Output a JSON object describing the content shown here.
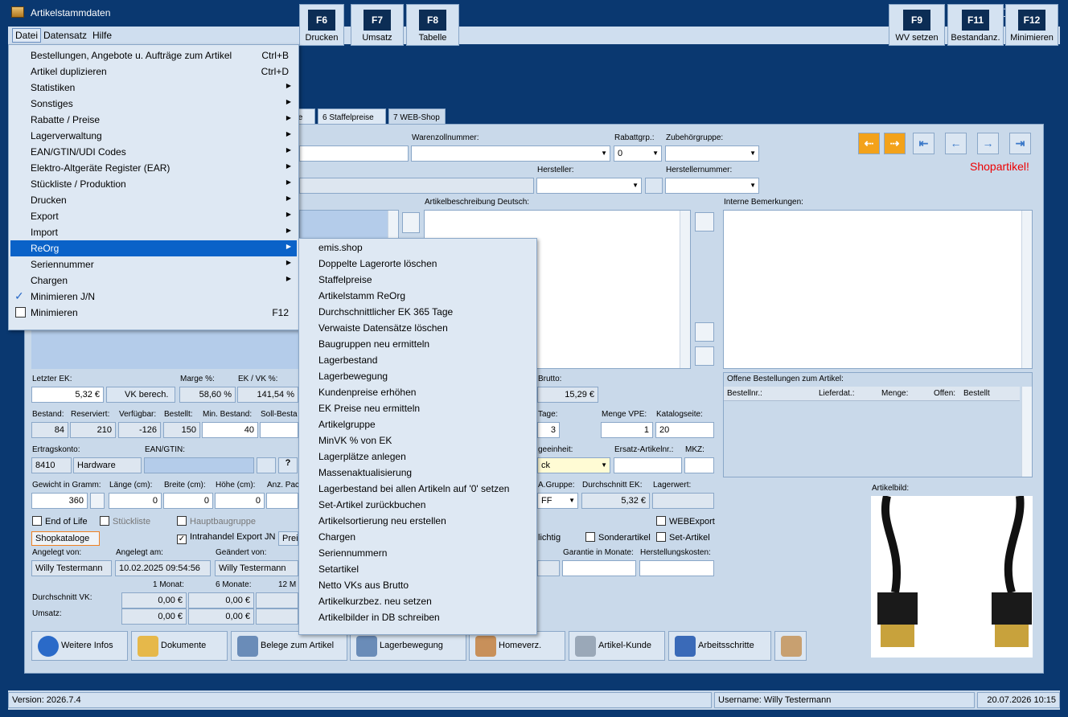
{
  "window": {
    "title": "Artikelstammdaten",
    "minimize": "—",
    "maximize": "☐",
    "close": "✕"
  },
  "menubar": {
    "datei": "Datei",
    "datensatz": "Datensatz",
    "hilfe": "Hilfe"
  },
  "fkeys": [
    {
      "key": "F6",
      "label": "Drucken"
    },
    {
      "key": "F7",
      "label": "Umsatz"
    },
    {
      "key": "F8",
      "label": "Tabelle"
    },
    {
      "key": "F9",
      "label": "WV setzen"
    },
    {
      "key": "F11",
      "label": "Bestandanz."
    },
    {
      "key": "F12",
      "label": "Minimieren"
    }
  ],
  "tabs": {
    "t5": "te",
    "t6": "6 Staffelpreise",
    "t7": "7 WEB-Shop"
  },
  "labels": {
    "warenzoll": "Warenzollnummer:",
    "rabattgrp": "Rabattgrp.:",
    "zubehoer": "Zubehörgruppe:",
    "hersteller": "Hersteller:",
    "herstellernr": "Herstellernummer:",
    "beschreibung": "Artikelbeschreibung Deutsch:",
    "interne": "Interne Bemerkungen:",
    "letzterEk": "Letzter EK:",
    "marge": "Marge %:",
    "ekvk": "EK / VK %:",
    "brutto": "Brutto:",
    "bestand": "Bestand:",
    "reserviert": "Reserviert:",
    "verfuegbar": "Verfügbar:",
    "bestellt": "Bestellt:",
    "minBestand": "Min. Bestand:",
    "sollBestand": "Soll-Besta",
    "tage": "Tage:",
    "mengeVpe": "Menge VPE:",
    "katalogseite": "Katalogseite:",
    "ertragskonto": "Ertragskonto:",
    "ean": "EAN/GTIN:",
    "einheit": "geeinheit:",
    "ersatz": "Ersatz-Artikelnr.:",
    "mkz": "MKZ:",
    "gewicht": "Gewicht in Gramm:",
    "laenge": "Länge (cm):",
    "breite": "Breite (cm):",
    "hoehe": "Höhe (cm):",
    "anzPac": "Anz. Pac",
    "agruppe": "A.Gruppe:",
    "durchEk": "Durchschnitt EK:",
    "lagerwert": "Lagerwert:",
    "angelegtVon": "Angelegt von:",
    "angelegtAm": "Angelegt am:",
    "geaendertVon": "Geändert von:",
    "garantie": "Garantie in Monate:",
    "herstellkosten": "Herstellungskosten:",
    "monat1": "1 Monat:",
    "monate6": "6 Monate:",
    "monate12": "12 M",
    "durchVk": "Durchschnitt VK:",
    "umsatz": "Umsatz:",
    "offene": "Offene Bestellungen zum Artikel:",
    "artikelbild": "Artikelbild:",
    "shopartikel": "Shopartikel!"
  },
  "orders_columns": [
    "Bestellnr.:",
    "Lieferdat.:",
    "Menge:",
    "Offen:",
    "Bestellt"
  ],
  "values": {
    "rabattgrp": "0",
    "letzterEk": "5,32 €",
    "vkBerech": "VK berech.",
    "marge": "58,60 %",
    "ekvk": "141,54 %",
    "brutto": "15,29 €",
    "bestand": "84",
    "reserviert": "210",
    "verfuegbar": "-126",
    "bestellt": "150",
    "minBestand": "40",
    "tage": "3",
    "mengeVpe": "1",
    "katalogseite": "20",
    "ertragskonto": "8410",
    "ertragsname": "Hardware",
    "einheit": "ck",
    "gewicht": "360",
    "laenge": "0",
    "breite": "0",
    "hoehe": "0",
    "agruppe": "FF",
    "durchEk": "5,32 €",
    "angelegtVon": "Willy Testermann",
    "angelegtAm": "10.02.2025 09:54:56",
    "geaendertVon": "Willy Testermann",
    "vk1": "0,00 €",
    "vk6": "0,00 €",
    "u1": "0,00 €",
    "u6": "0,00 €",
    "prei": "Prei"
  },
  "checkboxes": {
    "endOfLife": "End of Life",
    "stueckliste": "Stückliste",
    "hauptbaugruppe": "Hauptbaugruppe",
    "intrahandel": "Intrahandel Export JN",
    "webexport": "WEBExport",
    "pflichtig": "lichtig",
    "sonderartikel": "Sonderartikel",
    "setartikel": "Set-Artikel",
    "shopkataloge": "Shopkataloge"
  },
  "bottom_buttons": [
    "Weitere Infos",
    "Dokumente",
    "Belege zum Artikel",
    "Lagerbewegung",
    "Homeverz.",
    "Artikel-Kunde",
    "Arbeitsschritte"
  ],
  "status": {
    "version": "Version: 2026.7.4",
    "user": "Username: Willy Testermann",
    "datetime": "20.07.2026 10:15"
  },
  "datei_menu": [
    {
      "label": "Bestellungen, Angebote u. Aufträge zum Artikel",
      "shortcut": "Ctrl+B"
    },
    {
      "label": "Artikel duplizieren",
      "shortcut": "Ctrl+D"
    },
    {
      "label": "Statistiken",
      "arrow": "▶"
    },
    {
      "label": "Sonstiges",
      "arrow": "▶"
    },
    {
      "label": "Rabatte / Preise",
      "arrow": "▶"
    },
    {
      "label": "Lagerverwaltung",
      "arrow": "▶"
    },
    {
      "label": "EAN/GTIN/UDI Codes",
      "arrow": "▶"
    },
    {
      "label": "Elektro-Altgeräte Register (EAR)",
      "arrow": "▶"
    },
    {
      "label": "Stückliste / Produktion",
      "arrow": "▶"
    },
    {
      "label": "Drucken",
      "arrow": "▶"
    },
    {
      "label": "Export",
      "arrow": "▶"
    },
    {
      "label": "Import",
      "arrow": "▶"
    },
    {
      "label": "ReOrg",
      "arrow": "▶"
    },
    {
      "label": "Seriennummer",
      "arrow": "▶"
    },
    {
      "label": "Chargen",
      "arrow": "▶"
    },
    {
      "label": "Minimieren J/N",
      "check": "✓"
    },
    {
      "label": "Minimieren",
      "shortcut": "F12"
    }
  ],
  "reorg_menu": [
    "emis.shop",
    "Doppelte Lagerorte löschen",
    "Staffelpreise",
    "Artikelstamm ReOrg",
    "Durchschnittlicher EK 365 Tage",
    "Verwaiste Datensätze löschen",
    "Baugruppen neu ermitteln",
    "Lagerbestand",
    "Lagerbewegung",
    "Kundenpreise erhöhen",
    "EK Preise neu ermitteln",
    "Artikelgruppe",
    "MinVK % von EK",
    "Lagerplätze anlegen",
    "Massenaktualisierung",
    "Lagerbestand bei allen Artikeln auf '0' setzen",
    "Set-Artikel zurückbuchen",
    "Artikelsortierung neu erstellen",
    "Chargen",
    "Seriennummern",
    "Setartikel",
    "Netto VKs aus Brutto",
    "Artikelkurzbez. neu setzen",
    "Artikelbilder in DB schreiben"
  ]
}
